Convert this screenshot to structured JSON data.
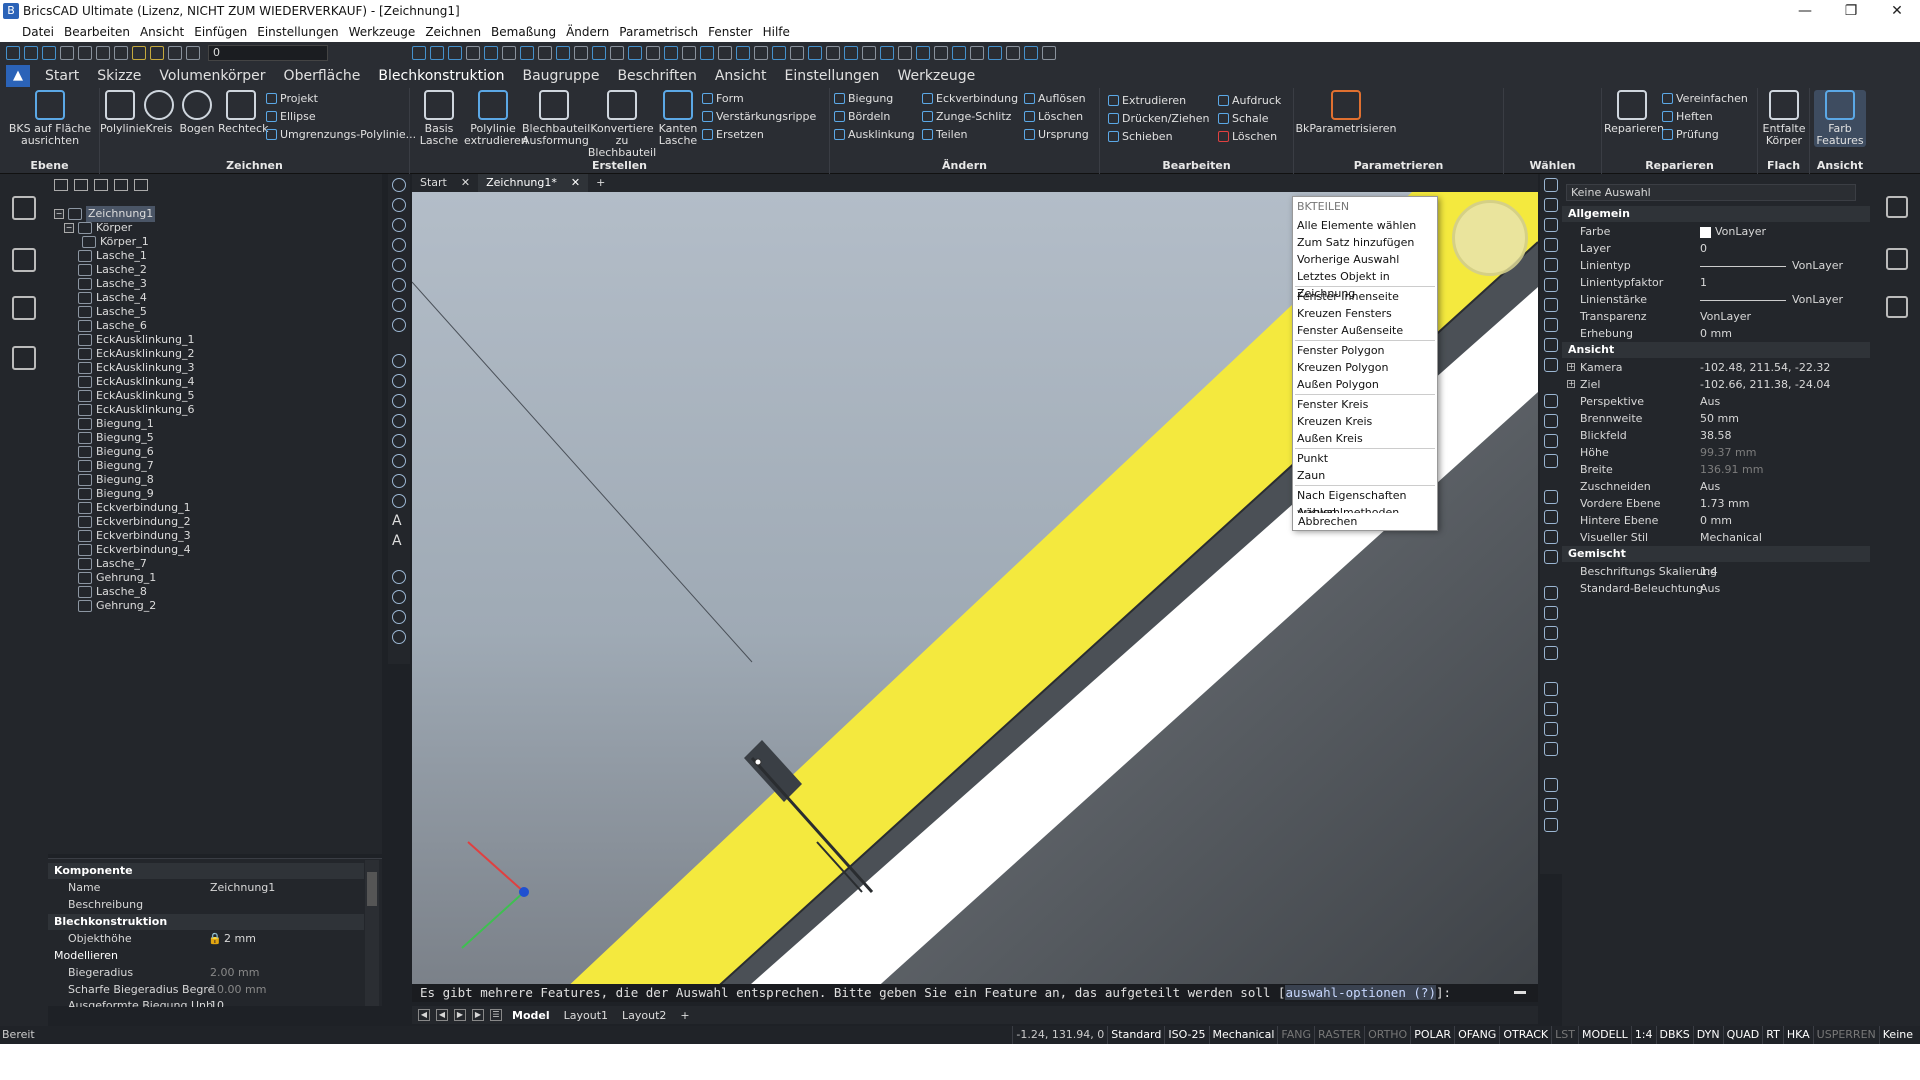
{
  "titlebar": {
    "title": "BricsCAD Ultimate (Lizenz, NICHT ZUM WIEDERVERKAUF) - [Zeichnung1]"
  },
  "menu": [
    "Datei",
    "Bearbeiten",
    "Ansicht",
    "Einfügen",
    "Einstellungen",
    "Werkzeuge",
    "Zeichnen",
    "Bemaßung",
    "Ändern",
    "Parametrisch",
    "Fenster",
    "Hilfe"
  ],
  "qat": {
    "layer": "0"
  },
  "tabs": [
    "Start",
    "Skizze",
    "Volumenkörper",
    "Oberfläche",
    "Blechkonstruktion",
    "Baugruppe",
    "Beschriften",
    "Ansicht",
    "Einstellungen",
    "Werkzeuge"
  ],
  "ribbon": {
    "ebene": {
      "label": "Ebene",
      "btn": "BKS auf Fläche ausrichten"
    },
    "zeichnen": {
      "label": "Zeichnen",
      "big": [
        "Polylinie",
        "Kreis",
        "Bogen",
        "Rechteck"
      ],
      "small": [
        "Projekt",
        "Ellipse",
        "Umgrenzungs-Polylinie..."
      ]
    },
    "erstellen": {
      "label": "Erstellen",
      "big": [
        "Basis Lasche",
        "Polylinie extrudieren",
        "Blechbauteil Ausformung",
        "Konvertiere zu Blechbauteil",
        "Kanten Lasche"
      ],
      "small": [
        "Form",
        "Verstärkungsrippe",
        "Ersetzen"
      ]
    },
    "aendern": {
      "label": "Ändern",
      "small": [
        "Biegung",
        "Bördeln",
        "Ausklinkung",
        "Eckverbindung",
        "Zunge-Schlitz",
        "Teilen",
        "Auflösen",
        "Löschen",
        "Ursprung"
      ]
    },
    "bearbeiten": {
      "label": "Bearbeiten",
      "small": [
        "Extrudieren",
        "Drücken/Ziehen",
        "Schieben",
        "Aufdruck",
        "Schale",
        "Löschen"
      ]
    },
    "parametrieren": {
      "label": "Parametrieren",
      "big": [
        "BkParametrisieren"
      ]
    },
    "waehlen": {
      "label": "Wählen"
    },
    "reparieren": {
      "label": "Reparieren",
      "big": [
        "Reparieren"
      ],
      "small": [
        "Vereinfachen",
        "Heften",
        "Prüfung"
      ]
    },
    "flach": {
      "label": "Flach",
      "big": [
        "Entfalte Körper"
      ]
    },
    "ansicht": {
      "label": "Ansicht",
      "big": [
        "Farb Features"
      ]
    }
  },
  "tree": {
    "root": "Zeichnung1",
    "nodes": [
      "Körper",
      "Körper_1",
      "Lasche_1",
      "Lasche_2",
      "Lasche_3",
      "Lasche_4",
      "Lasche_5",
      "Lasche_6",
      "EckAusklinkung_1",
      "EckAusklinkung_2",
      "EckAusklinkung_3",
      "EckAusklinkung_4",
      "EckAusklinkung_5",
      "EckAusklinkung_6",
      "Biegung_1",
      "Biegung_5",
      "Biegung_6",
      "Biegung_7",
      "Biegung_8",
      "Biegung_9",
      "Eckverbindung_1",
      "Eckverbindung_2",
      "Eckverbindung_3",
      "Eckverbindung_4",
      "Lasche_7",
      "Gehrung_1",
      "Lasche_8",
      "Gehrung_2"
    ]
  },
  "component": {
    "h1": "Komponente",
    "name_k": "Name",
    "name_v": "Zeichnung1",
    "desc_k": "Beschreibung",
    "h2": "Blechkonstruktion",
    "obj_k": "Objekthöhe",
    "obj_v": "2 mm",
    "h3": "Modellieren",
    "r1_k": "Biegeradius",
    "r1_v": "2.00 mm",
    "r2_k": "Scharfe Biegeradius Begre",
    "r2_v": "10.00 mm",
    "r3_k": "Ausgeformte Biegung Unb",
    "r3_v": "10"
  },
  "doctabs": [
    "Start",
    "Zeichnung1*"
  ],
  "ctxmenu": {
    "header": "BKTEILEN",
    "items": [
      "Alle Elemente wählen",
      "Zum Satz hinzufügen",
      "Vorherige Auswahl",
      "Letztes Objekt in Zeichnung",
      "Fenster Innenseite",
      "Kreuzen Fensters",
      "Fenster Außenseite",
      "Fenster Polygon",
      "Kreuzen Polygon",
      "Außen Polygon",
      "Fenster Kreis",
      "Kreuzen Kreis",
      "Außen Kreis",
      "Punkt",
      "Zaun",
      "Nach Eigenschaften wählen...",
      "Auswahlmethoden...",
      "Abbrechen"
    ]
  },
  "cmdline": {
    "text": "Es gibt mehrere Features, die der Auswahl entsprechen. Bitte geben Sie ein Feature an, das aufgeteilt werden soll [",
    "opt": "auswahl-optionen (?)",
    "end": "]:"
  },
  "layouttabs": [
    "Model",
    "Layout1",
    "Layout2",
    "+"
  ],
  "props": {
    "selection": "Keine Auswahl",
    "allgemein": "Allgemein",
    "rows1": [
      [
        "Farbe",
        "VonLayer"
      ],
      [
        "Layer",
        "0"
      ],
      [
        "Linientyp",
        "VonLayer"
      ],
      [
        "Linientypfaktor",
        "1"
      ],
      [
        "Linienstärke",
        "VonLayer"
      ],
      [
        "Transparenz",
        "VonLayer"
      ],
      [
        "Erhebung",
        "0 mm"
      ]
    ],
    "ansicht": "Ansicht",
    "rows2": [
      [
        "Kamera",
        "-102.48, 211.54, -22.32"
      ],
      [
        "Ziel",
        "-102.66, 211.38, -24.04"
      ],
      [
        "Perspektive",
        "Aus"
      ],
      [
        "Brennweite",
        "50 mm"
      ],
      [
        "Blickfeld",
        "38.58"
      ],
      [
        "Höhe",
        "99.37 mm"
      ],
      [
        "Breite",
        "136.91 mm"
      ],
      [
        "Zuschneiden",
        "Aus"
      ],
      [
        "Vordere Ebene",
        "1.73 mm"
      ],
      [
        "Hintere Ebene",
        "0 mm"
      ],
      [
        "Visueller Stil",
        "Mechanical"
      ]
    ],
    "gemischt": "Gemischt",
    "rows3": [
      [
        "Beschriftungs Skalierung",
        "1:4"
      ],
      [
        "Standard-Beleuchtung",
        "Aus"
      ]
    ]
  },
  "status": {
    "left": "Bereit",
    "coords": "-1.24, 131.94, 0",
    "items": [
      "Standard",
      "ISO-25",
      "Mechanical",
      "FANG",
      "RASTER",
      "ORTHO",
      "POLAR",
      "OFANG",
      "OTRACK",
      "LST",
      "MODELL",
      "1:4",
      "DBKS",
      "DYN",
      "QUAD",
      "RT",
      "HKA",
      "USPERREN",
      "Keine"
    ]
  },
  "colors": {
    "accent": "#2b63b8",
    "yellow": "#f4e93e",
    "canvas": "#a7b4c1"
  }
}
